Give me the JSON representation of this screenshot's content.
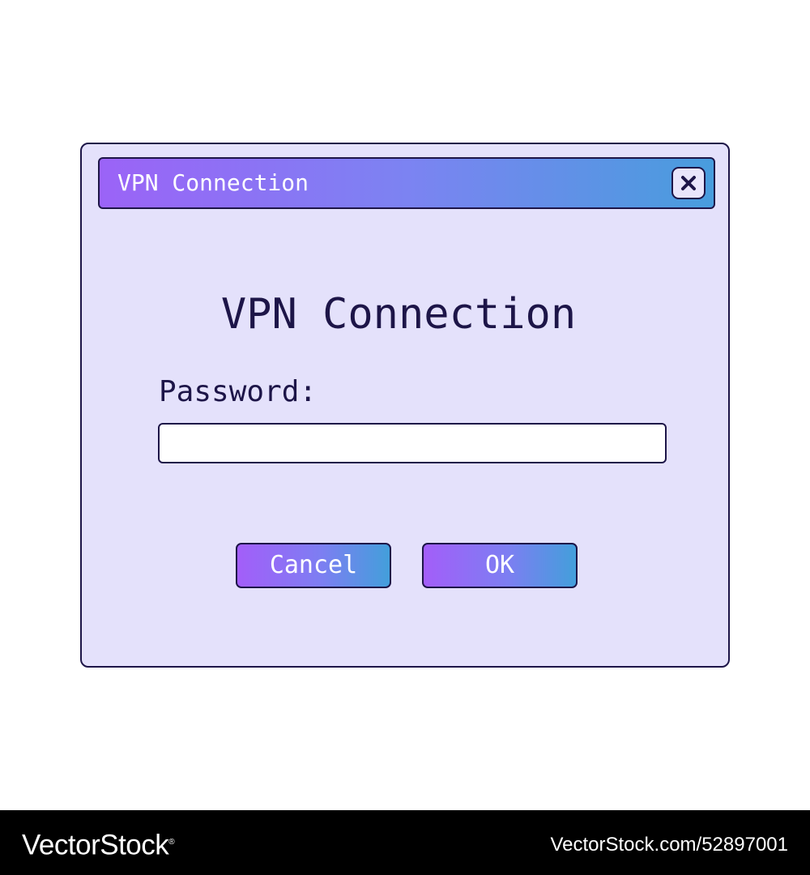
{
  "window": {
    "title": "VPN Connection",
    "close_icon": "close-x-icon"
  },
  "dialog": {
    "heading": "VPN Connection",
    "password_label": "Password:",
    "password_value": "",
    "cancel_label": "Cancel",
    "ok_label": "OK"
  },
  "footer": {
    "brand": "VectorStock",
    "brand_registered": "®",
    "image_id": "VectorStock.com/52897001"
  },
  "colors": {
    "dialog_background": "#e4e1fb",
    "outline": "#1d1548",
    "gradient_start": "#9b63f7",
    "gradient_end": "#489ddd",
    "footer_background": "#000000"
  }
}
